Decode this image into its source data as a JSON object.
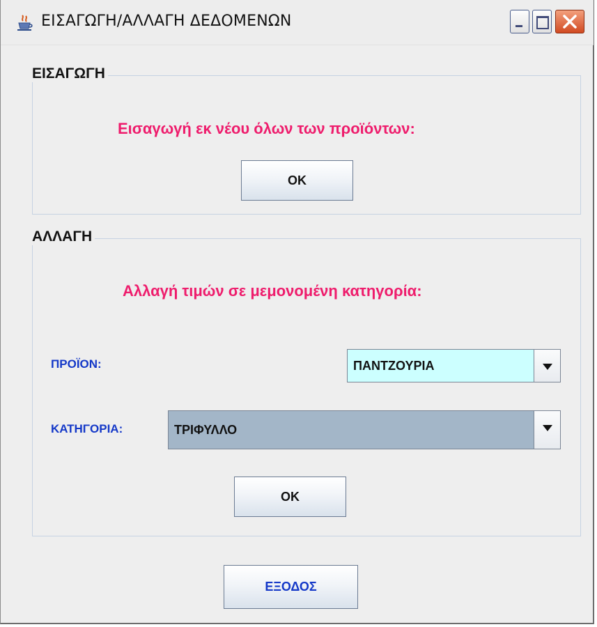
{
  "window": {
    "title": "ΕΙΣΑΓΩΓΗ/ΑΛΛΑΓΗ ΔΕΔΟΜΕΝΩΝ",
    "title_icon": "java-cup-icon"
  },
  "insert_section": {
    "title": "ΕΙΣΑΓΩΓΗ",
    "instruction": "Εισαγωγή εκ νέου όλων των προϊόντων:",
    "ok_label": "OK"
  },
  "change_section": {
    "title": "ΑΛΛΑΓΗ",
    "instruction": "Αλλαγή τιμών σε μεμονομένη κατηγορία:",
    "product_label": "ΠΡΟΪΟΝ:",
    "product_value": "ΠΑΝΤΖΟΥΡΙΑ",
    "category_label": "ΚΑΤΗΓΟΡΙΑ:",
    "category_value": "ΤΡΙΦΥΛΛΟ",
    "ok_label": "OK"
  },
  "exit_label": "ΕΞΟΔΟΣ",
  "colors": {
    "instruction": "#ee1c6c",
    "field_label": "#1438c8",
    "product_combo_bg": "#ccffff",
    "category_combo_bg": "#a3b6c8"
  }
}
